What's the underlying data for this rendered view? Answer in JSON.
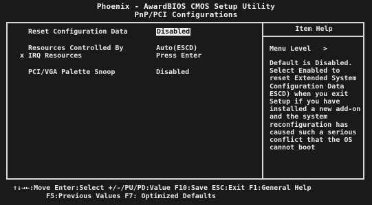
{
  "title": {
    "line1": "Phoenix - AwardBIOS CMOS Setup Utility",
    "line2": "PnP/PCI Configurations"
  },
  "options": [
    {
      "label": "Reset Configuration Data",
      "value": "Disabled"
    },
    {
      "label": "Resources Controlled By",
      "value": "Auto(ESCD)"
    },
    {
      "label": "IRQ Resources",
      "value": "Press Enter"
    },
    {
      "label": "PCI/VGA Palette Snoop",
      "value": "Disabled"
    }
  ],
  "submenu_marker": "x",
  "help": {
    "header": "Item Help",
    "menu_level_label": "Menu Level",
    "menu_level_marker": ">",
    "text": "Default is Disabled.\nSelect Enabled to\nreset Extended System\nConfiguration Data\nESCD) when you exit\nSetup if you have\ninstalled a new add-on\nand the system\nreconfiguration has\ncaused such a serious\nconflict that the OS\ncannot boot"
  },
  "footer": {
    "line1": "↑↓→←:Move   Enter:Select   +/-/PU/PD:Value   F10:Save   ESC:Exit   F1:General Help",
    "line2": "F5:Previous Values                     F7: Optimized Defaults"
  },
  "colors": {
    "background": "#1a1a1a",
    "text": "#e6e6e6",
    "highlight_bg": "#f0f0f0",
    "highlight_fg": "#141414"
  }
}
